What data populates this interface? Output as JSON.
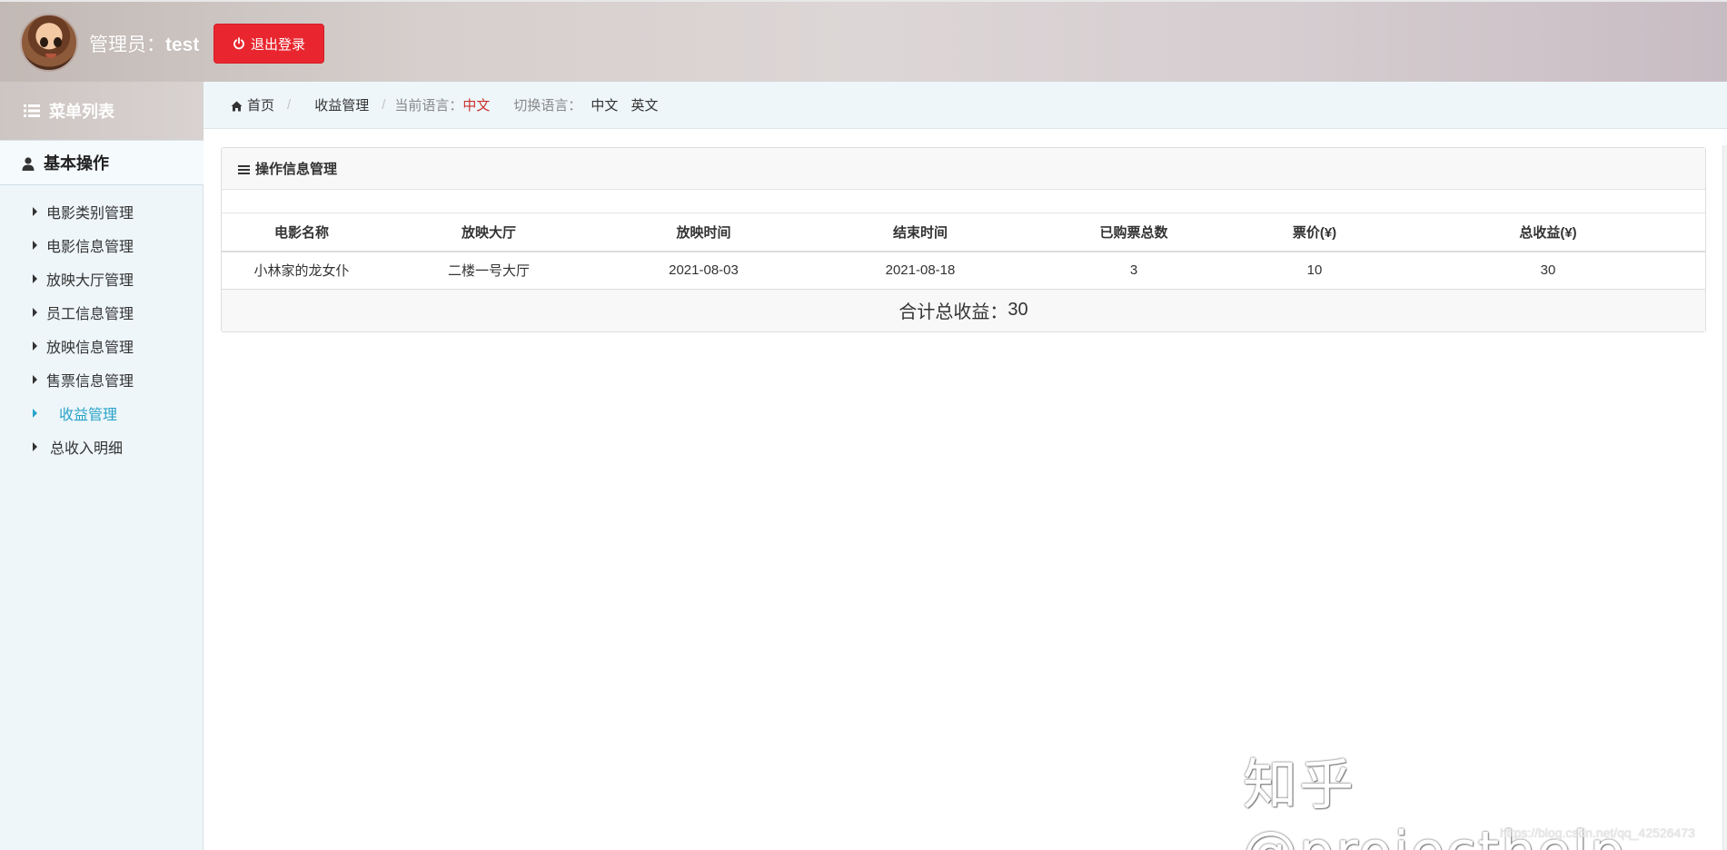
{
  "header": {
    "admin_label": "管理员：",
    "admin_name": "test",
    "logout_label": "退出登录"
  },
  "sidebar": {
    "menu_title": "菜单列表",
    "section_title": "基本操作",
    "items": [
      {
        "label": "电影类别管理"
      },
      {
        "label": "电影信息管理"
      },
      {
        "label": "放映大厅管理"
      },
      {
        "label": "员工信息管理"
      },
      {
        "label": "放映信息管理"
      },
      {
        "label": "售票信息管理"
      },
      {
        "label": "收益管理",
        "active": true
      },
      {
        "label": "总收入明细"
      }
    ]
  },
  "breadcrumb": {
    "home": "首页",
    "current": "收益管理",
    "current_lang_label": "当前语言：",
    "current_lang": "中文",
    "switch_label": "切换语言：",
    "lang_zh": "中文",
    "lang_en": "英文"
  },
  "panel": {
    "title": "操作信息管理",
    "columns": [
      "电影名称",
      "放映大厅",
      "放映时间",
      "结束时间",
      "已购票总数",
      "票价(¥)",
      "总收益(¥)"
    ],
    "rows": [
      [
        "小林家的龙女仆",
        "二楼一号大厅",
        "2021-08-03",
        "2021-08-18",
        "3",
        "10",
        "30"
      ]
    ],
    "total_label": "合计总收益：",
    "total_value": "30"
  },
  "watermark": {
    "zhihu": "知乎 @projecthelp",
    "csdn": "https://blog.csdn.net/qq_42526473"
  },
  "colors": {
    "logout_bg": "#e9262f",
    "active_menu": "#2aa3c7",
    "current_lang": "#c9302c",
    "sidebar_bg": "#eef6fa"
  }
}
